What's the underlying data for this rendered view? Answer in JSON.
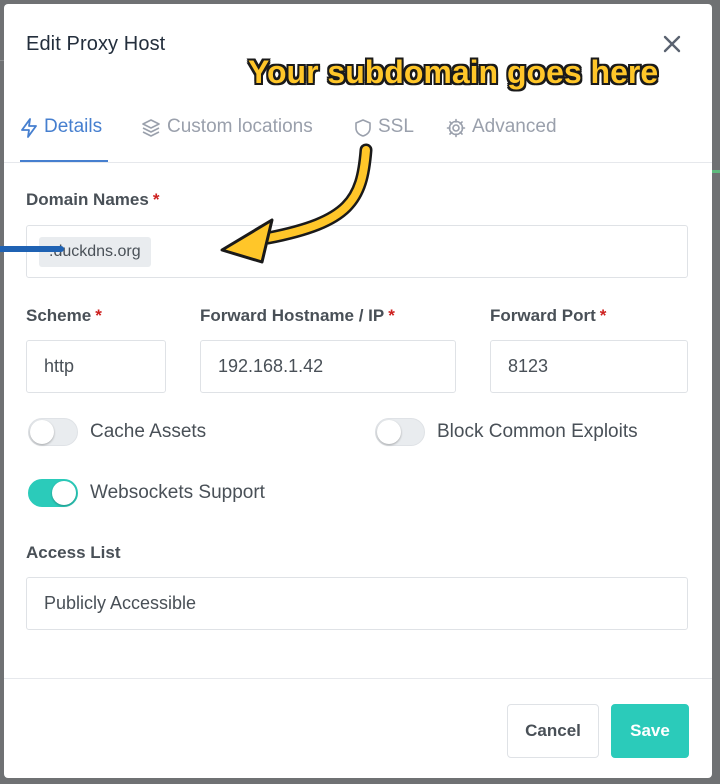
{
  "modal": {
    "title": "Edit Proxy Host"
  },
  "tabs": [
    {
      "label": "Details",
      "icon": "bolt-icon",
      "active": true
    },
    {
      "label": "Custom locations",
      "icon": "layers-icon",
      "active": false
    },
    {
      "label": "SSL",
      "icon": "shield-icon",
      "active": false
    },
    {
      "label": "Advanced",
      "icon": "gear-icon",
      "active": false
    }
  ],
  "annotation": {
    "text": "Your subdomain goes here",
    "color": "#ffc629"
  },
  "form": {
    "domain_names": {
      "label": "Domain Names",
      "required": "*",
      "chip": ".duckdns.org"
    },
    "scheme": {
      "label": "Scheme",
      "required": "*",
      "value": "http"
    },
    "forward_host": {
      "label": "Forward Hostname / IP",
      "required": "*",
      "value": "192.168.1.42"
    },
    "forward_port": {
      "label": "Forward Port",
      "required": "*",
      "value": "8123"
    },
    "toggles": [
      {
        "label": "Cache Assets",
        "on": false
      },
      {
        "label": "Block Common Exploits",
        "on": false
      },
      {
        "label": "Websockets Support",
        "on": true
      }
    ],
    "access_list": {
      "label": "Access List",
      "value": "Publicly Accessible"
    }
  },
  "footer": {
    "cancel_label": "Cancel",
    "save_label": "Save"
  },
  "colors": {
    "primary": "#467fcf",
    "teal": "#2bcbba",
    "required": "#cd201f"
  }
}
